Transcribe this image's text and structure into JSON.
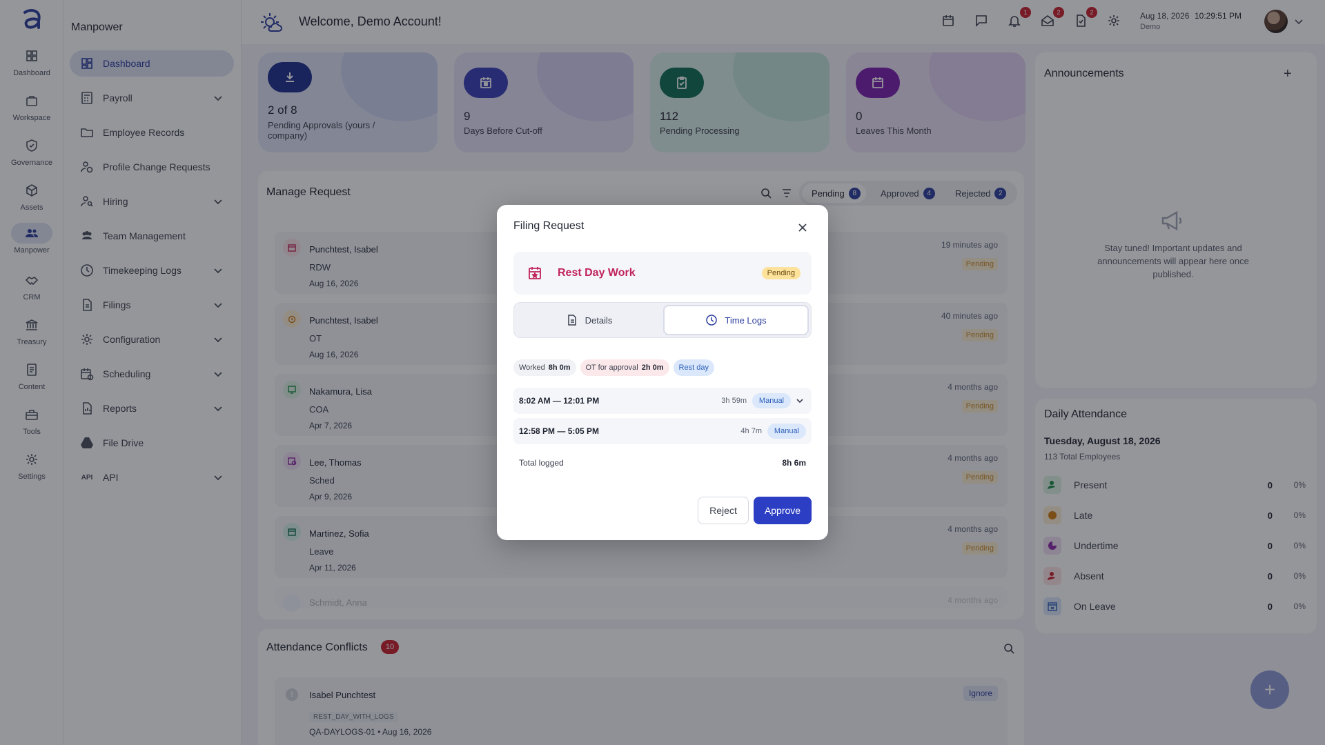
{
  "rail": [
    {
      "label": "Dashboard",
      "icon": "dashboard-icon"
    },
    {
      "label": "Workspace",
      "icon": "briefcase-icon"
    },
    {
      "label": "Governance",
      "icon": "shield-icon"
    },
    {
      "label": "Assets",
      "icon": "cube-icon"
    },
    {
      "label": "Manpower",
      "icon": "people-icon"
    },
    {
      "label": "CRM",
      "icon": "handshake-icon"
    },
    {
      "label": "Treasury",
      "icon": "bank-icon"
    },
    {
      "label": "Content",
      "icon": "document-icon"
    },
    {
      "label": "Tools",
      "icon": "toolbox-icon"
    },
    {
      "label": "Settings",
      "icon": "gear-icon"
    }
  ],
  "sidebar": {
    "title": "Manpower",
    "items": [
      {
        "label": "Dashboard"
      },
      {
        "label": "Payroll"
      },
      {
        "label": "Employee Records"
      },
      {
        "label": "Profile Change Requests"
      },
      {
        "label": "Hiring"
      },
      {
        "label": "Team Management"
      },
      {
        "label": "Timekeeping Logs"
      },
      {
        "label": "Filings"
      },
      {
        "label": "Configuration"
      },
      {
        "label": "Scheduling"
      },
      {
        "label": "Reports"
      },
      {
        "label": "File Drive"
      },
      {
        "label": "API",
        "icon_text": "API"
      }
    ]
  },
  "header": {
    "welcome": "Welcome, Demo Account!",
    "badges": {
      "notifications": "1",
      "inbox": "2",
      "tasks": "2"
    },
    "date": "Aug 18, 2026",
    "time": "10:29:51 PM",
    "user": "Demo"
  },
  "stats": [
    {
      "value": "2 of 8",
      "label": "Pending Approvals (yours / company)"
    },
    {
      "value": "9",
      "label": "Days Before Cut-off"
    },
    {
      "value": "112",
      "label": "Pending Processing"
    },
    {
      "value": "0",
      "label": "Leaves This Month"
    }
  ],
  "manage": {
    "title": "Manage Request",
    "tabs": [
      {
        "label": "Pending",
        "count": "8"
      },
      {
        "label": "Approved",
        "count": "4"
      },
      {
        "label": "Rejected",
        "count": "2"
      }
    ],
    "rows": [
      {
        "name": "Punchtest, Isabel",
        "type": "RDW",
        "date": "Aug 16, 2026",
        "ago": "19 minutes ago",
        "status": "Pending"
      },
      {
        "name": "Punchtest, Isabel",
        "type": "OT",
        "date": "Aug 16, 2026",
        "ago": "40 minutes ago",
        "status": "Pending"
      },
      {
        "name": "Nakamura, Lisa",
        "type": "COA",
        "date": "Apr 7, 2026",
        "ago": "4 months ago",
        "status": "Pending"
      },
      {
        "name": "Lee, Thomas",
        "type": "Sched",
        "date": "Apr 9, 2026",
        "ago": "4 months ago",
        "status": "Pending"
      },
      {
        "name": "Martinez, Sofia",
        "type": "Leave",
        "date": "Apr 11, 2026",
        "ago": "4 months ago",
        "status": "Pending"
      },
      {
        "name": "Schmidt, Anna",
        "ago": "4 months ago"
      }
    ]
  },
  "conflicts": {
    "title": "Attendance Conflicts",
    "count": "10",
    "row": {
      "name": "Isabel Punchtest",
      "code": "REST_DAY_WITH_LOGS",
      "ref": "QA-DAYLOGS-01 • Aug 16, 2026",
      "action": "Ignore"
    }
  },
  "announcements": {
    "title": "Announcements",
    "empty": "Stay tuned! Important updates and announcements will appear here once published."
  },
  "attendance": {
    "title": "Daily Attendance",
    "date": "Tuesday, August 18, 2026",
    "total": "113 Total Employees",
    "rows": [
      {
        "label": "Present",
        "count": "0",
        "pct": "0%"
      },
      {
        "label": "Late",
        "count": "0",
        "pct": "0%"
      },
      {
        "label": "Undertime",
        "count": "0",
        "pct": "0%"
      },
      {
        "label": "Absent",
        "count": "0",
        "pct": "0%"
      },
      {
        "label": "On Leave",
        "count": "0",
        "pct": "0%"
      }
    ]
  },
  "modal": {
    "title": "Filing Request",
    "request_type": "Rest Day Work",
    "status": "Pending",
    "tabs": {
      "details": "Details",
      "time_logs": "Time Logs"
    },
    "summary": {
      "worked_label": "Worked",
      "worked_value": "8h 0m",
      "ot_label": "OT for approval",
      "ot_value": "2h 0m",
      "rest_label": "Rest day"
    },
    "logs": [
      {
        "range": "8:02 AM — 12:01 PM",
        "duration": "3h 59m",
        "tag": "Manual"
      },
      {
        "range": "12:58 PM — 5:05 PM",
        "duration": "4h 7m",
        "tag": "Manual"
      }
    ],
    "total_label": "Total logged",
    "total_value": "8h 6m",
    "reject": "Reject",
    "approve": "Approve"
  },
  "colors": {
    "accent": "#2c3ec4",
    "rest_day": "#c0245a",
    "pending_badge": "#fde29b"
  }
}
